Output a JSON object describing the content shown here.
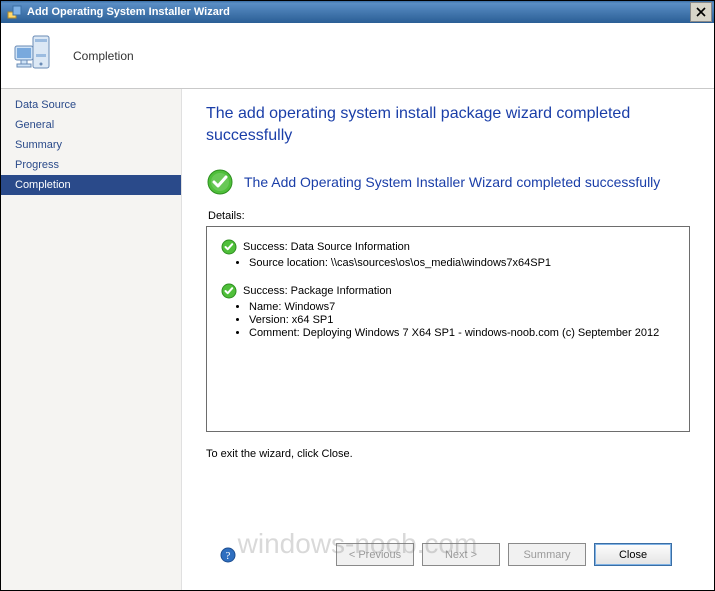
{
  "titlebar": {
    "title": "Add Operating System Installer Wizard"
  },
  "header": {
    "stage": "Completion"
  },
  "sidebar": {
    "items": [
      {
        "label": "Data Source"
      },
      {
        "label": "General"
      },
      {
        "label": "Summary"
      },
      {
        "label": "Progress"
      },
      {
        "label": "Completion",
        "active": true
      }
    ]
  },
  "main": {
    "heading": "The add operating system install package wizard completed successfully",
    "status": "The Add Operating System Installer Wizard completed successfully",
    "details_label": "Details:",
    "groups": [
      {
        "title": "Success: Data Source Information",
        "items": [
          "Source location: \\\\cas\\sources\\os\\os_media\\windows7x64SP1"
        ]
      },
      {
        "title": "Success: Package Information",
        "items": [
          "Name: Windows7",
          "Version: x64 SP1",
          "Comment: Deploying Windows 7 X64 SP1 - windows-noob.com (c) September 2012"
        ]
      }
    ],
    "exit_text": "To exit the wizard, click Close."
  },
  "footer": {
    "previous": "< Previous",
    "next": "Next >",
    "summary": "Summary",
    "close": "Close"
  },
  "watermark": "windows-noob.com"
}
